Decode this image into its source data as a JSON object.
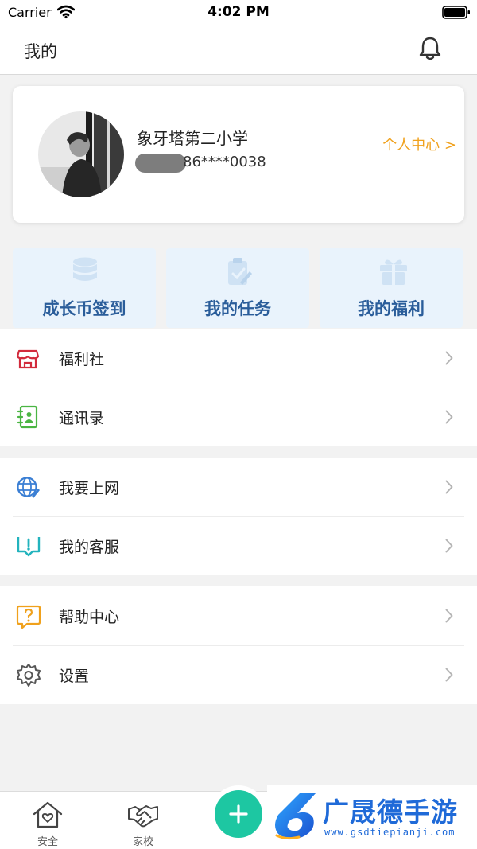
{
  "status_bar": {
    "carrier": "Carrier",
    "time": "4:02 PM"
  },
  "nav": {
    "title": "我的"
  },
  "profile": {
    "school": "象牙塔第二小学",
    "phone": "86****0038",
    "personal_center_link": "个人中心 >"
  },
  "quick_actions": [
    {
      "label": "成长币签到",
      "icon": "coin-stack-icon"
    },
    {
      "label": "我的任务",
      "icon": "task-clipboard-icon"
    },
    {
      "label": "我的福利",
      "icon": "gift-icon"
    }
  ],
  "menu": {
    "group1": [
      {
        "label": "福利社",
        "icon": "shop-icon"
      },
      {
        "label": "通讯录",
        "icon": "contacts-icon"
      }
    ],
    "group2": [
      {
        "label": "我要上网",
        "icon": "globe-icon"
      },
      {
        "label": "我的客服",
        "icon": "customer-service-icon"
      }
    ],
    "group3": [
      {
        "label": "帮助中心",
        "icon": "help-icon"
      },
      {
        "label": "设置",
        "icon": "gear-icon"
      }
    ]
  },
  "tab_bar": {
    "tabs": [
      {
        "label": "安全",
        "icon": "house-heart-icon"
      },
      {
        "label": "家校",
        "icon": "handshake-icon"
      }
    ],
    "fab_icon": "plus-icon"
  },
  "watermark": {
    "name": "广晟德手游",
    "url": "www.gsdtiepianji.com"
  },
  "colors": {
    "accent_orange": "#f0a11c",
    "tile_background": "#e9f3fc",
    "tile_text": "#2a5d9a",
    "fab_green": "#1dc7a2"
  }
}
